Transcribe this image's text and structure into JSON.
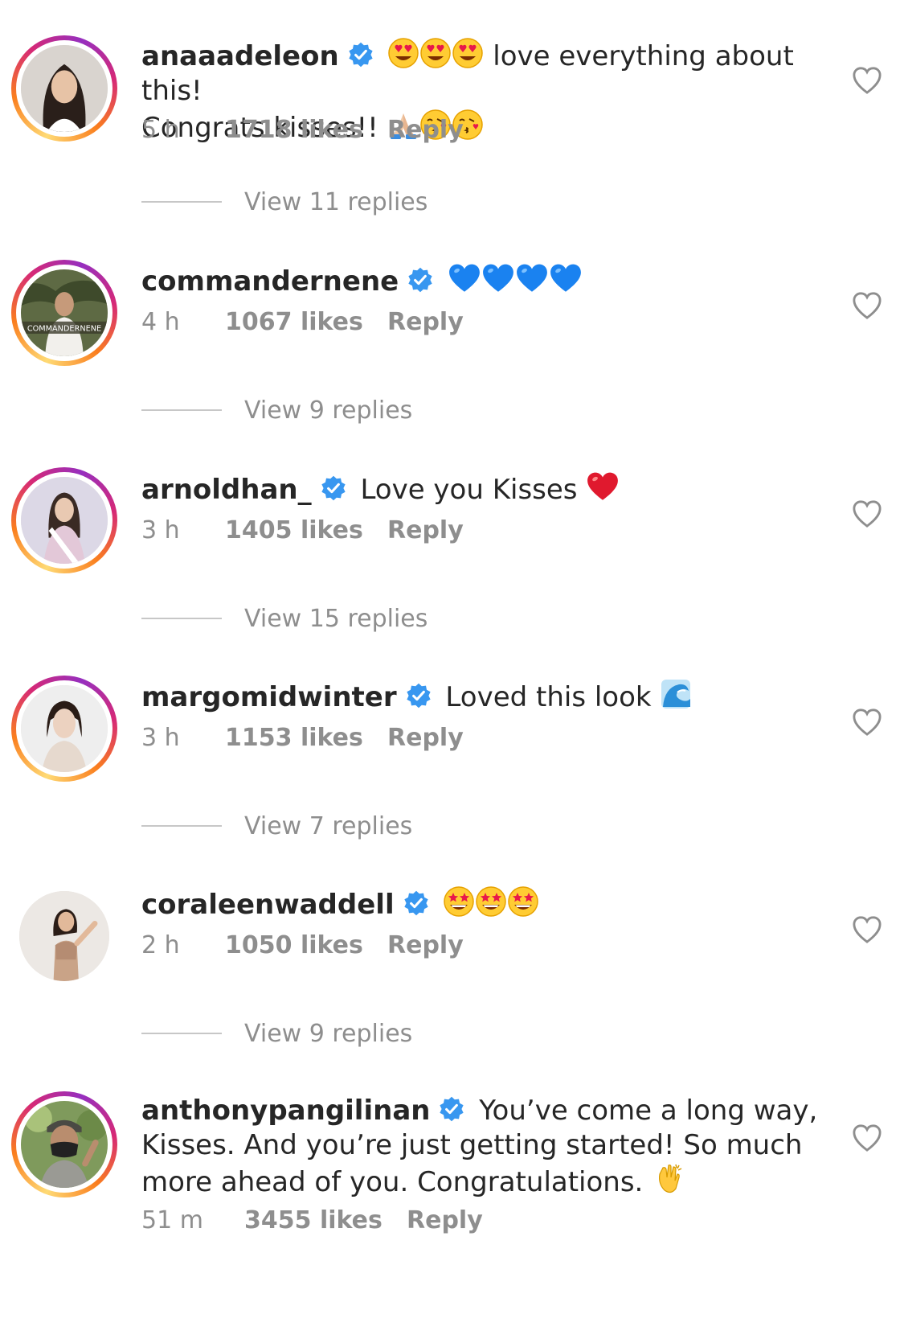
{
  "comments": [
    {
      "username": "anaaadeleon",
      "text_line1": "love everything about this!",
      "text_line2": "Congrats kisses!!",
      "time": "5 h",
      "likes": "1718 likes",
      "reply_label": "Reply",
      "view_replies": "View 11 replies"
    },
    {
      "username": "commandernene",
      "avatar_text": "COMMANDERNENE",
      "time": "4 h",
      "likes": "1067 likes",
      "reply_label": "Reply",
      "view_replies": "View 9 replies"
    },
    {
      "username": "arnoldhan_",
      "text": "Love you Kisses",
      "time": "3 h",
      "likes": "1405 likes",
      "reply_label": "Reply",
      "view_replies": "View 15 replies"
    },
    {
      "username": "margomidwinter",
      "text": "Loved this look",
      "time": "3 h",
      "likes": "1153 likes",
      "reply_label": "Reply",
      "view_replies": "View 7 replies"
    },
    {
      "username": "coraleenwaddell",
      "time": "2 h",
      "likes": "1050 likes",
      "reply_label": "Reply",
      "view_replies": "View 9 replies"
    },
    {
      "username": "anthonypangilinan",
      "text_line1": "You’ve come a long way,",
      "text_line2": "Kisses. And you’re just getting started! So much",
      "text_line3": "more ahead of you. Congratulations.",
      "time": "51 m",
      "likes": "3455 likes",
      "reply_label": "Reply"
    }
  ],
  "colors": {
    "verified_blue": "#3897f0",
    "secondary_text": "#8e8e8e",
    "primary_text": "#262626"
  },
  "icons": [
    "verified-badge-icon",
    "heart-outline-icon",
    "heart-eyes-emoji",
    "kissing-heart-emoji",
    "folded-hands-emoji",
    "blue-heart-emoji",
    "red-heart-emoji",
    "wave-emoji",
    "star-eyes-emoji",
    "clapping-hands-emoji"
  ]
}
